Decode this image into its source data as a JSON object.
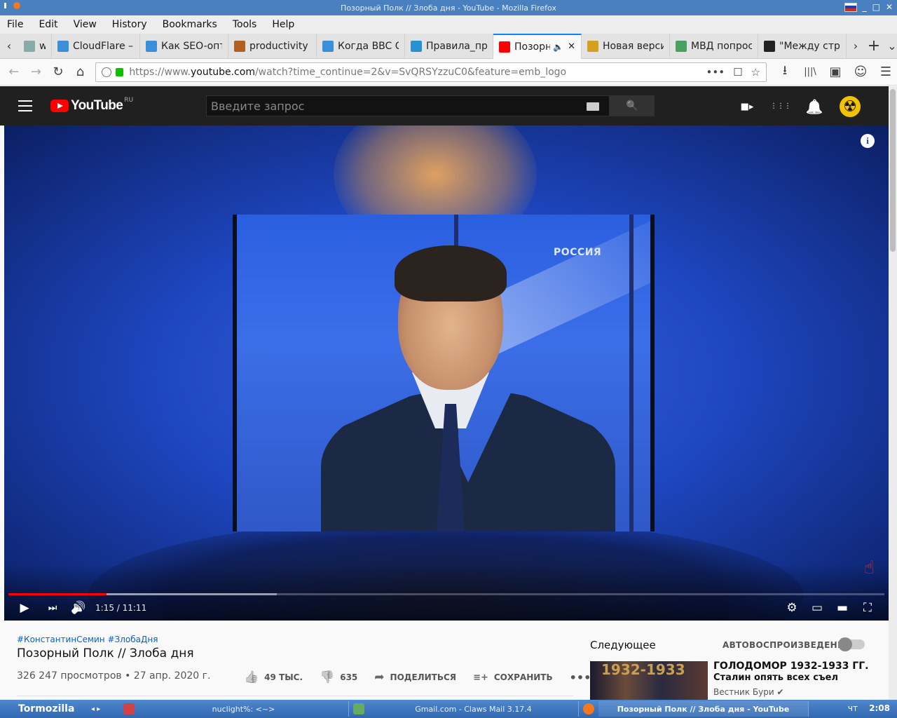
{
  "window": {
    "title": "Позорный Полк // Злоба дня - YouTube - Mozilla Firefox",
    "controls": [
      "_",
      "□",
      "✕"
    ]
  },
  "menubar": [
    "File",
    "Edit",
    "View",
    "History",
    "Bookmarks",
    "Tools",
    "Help"
  ],
  "tabs": [
    {
      "label": "w",
      "color": "#8aa"
    },
    {
      "label": "CloudFlare –",
      "color": "#3b8fd9"
    },
    {
      "label": "Как SEO-опт",
      "color": "#3b8fd9"
    },
    {
      "label": "productivity",
      "color": "#b06020"
    },
    {
      "label": "Когда BBC С",
      "color": "#3b8fd9"
    },
    {
      "label": "Правила_пр",
      "color": "#2a90d0"
    },
    {
      "label": "Позорн",
      "color": "#ff0000",
      "active": true
    },
    {
      "label": "Новая верси",
      "color": "#d4a020"
    },
    {
      "label": "МВД попрос",
      "color": "#4aa060"
    },
    {
      "label": "\"Между стр",
      "color": "#222"
    }
  ],
  "tab_icons": {
    "mute": "🔈",
    "close": "✕",
    "scroll_left": "‹",
    "scroll_right": "›",
    "new": "+",
    "list": "⌄"
  },
  "navbar": {
    "url_prefix": "https://www.",
    "url_domain": "youtube.com",
    "url_path": "/watch?time_continue=2&v=SvQRSYzzuC0&feature=emb_logo",
    "icons": [
      "←",
      "→",
      "↻",
      "⌂"
    ],
    "right_icons": [
      "⭳",
      "|||\\",
      "▣",
      "☺",
      "☰"
    ],
    "url_actions": [
      "•••",
      "☐",
      "☆"
    ]
  },
  "youtube": {
    "logo_text": "YouTube",
    "region": "RU",
    "search_placeholder": "Введите запрос",
    "search_icon": "🔍",
    "header_icons": [
      "■▸",
      "⋮⋮⋮",
      "🔔"
    ],
    "avatar_glyph": "☢"
  },
  "player": {
    "channel_watermark": "РОССИЯ",
    "info_glyph": "i",
    "hand_glyph": "☝",
    "current_time": "1:15",
    "duration": "11:11",
    "time_display": "1:15 / 11:11",
    "progress_played": 0.112,
    "progress_buffered": 0.306,
    "control_icons": {
      "play": "▶",
      "next": "⏭",
      "volume": "🔊",
      "settings": "⚙",
      "miniplayer": "▭",
      "theater": "▬",
      "fullscreen": "⛶"
    }
  },
  "video": {
    "hashtags": "#КонстантинСемин #ЗлобаДня",
    "title": "Позорный Полк // Злоба дня",
    "meta": "326 247 просмотров • 27 апр. 2020 г.",
    "likes": "49 ТЫС.",
    "dislikes": "635",
    "share_label": "ПОДЕЛИТЬСЯ",
    "save_label": "СОХРАНИТЬ",
    "more": "•••",
    "action_icons": {
      "like": "👍",
      "dislike": "👎",
      "share": "➦",
      "save": "≡+"
    }
  },
  "sidebar": {
    "next_label": "Следующее",
    "autoplay_label": "АВТОВОСПРОИЗВЕДЕНИЕ",
    "autoplay_on": false,
    "related": [
      {
        "thumb_text": "1932-1933",
        "title_line1": "ГОЛОДОМОР 1932-1933 ГГ.",
        "title_line2": "Сталин опять всех съел",
        "channel": "Вестник Бури ✔"
      }
    ]
  },
  "taskbar": {
    "start": "Tormozilla",
    "arrows": "◂ ▸",
    "items": [
      {
        "label": "nuclight%: <~>",
        "width": 320
      },
      {
        "label": "Gmail.com - Claws Mail 3.17.4",
        "width": 320
      },
      {
        "label": "Позорный Полк // Злоба дня - YouTube",
        "width": 320,
        "active": true
      }
    ],
    "lang": "чт",
    "clock": "2:08"
  }
}
